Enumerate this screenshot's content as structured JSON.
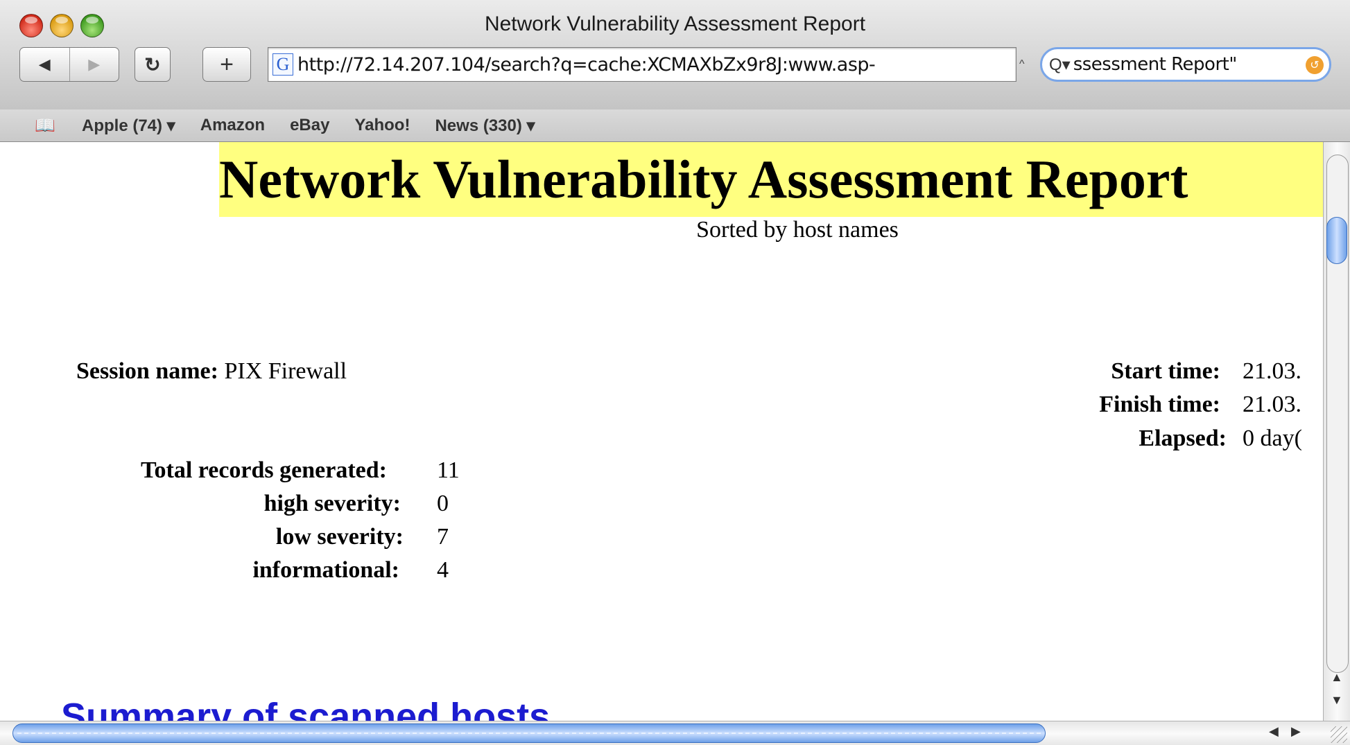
{
  "window": {
    "title": "Network Vulnerability Assessment Report"
  },
  "toolbar": {
    "back_icon": "back-arrow-icon",
    "forward_icon": "forward-arrow-icon",
    "reload_glyph": "↻",
    "add_glyph": "+",
    "url": "http://72.14.207.104/search?q=cache:XCMAXbZx9r8J:www.asp-",
    "favicon_letter": "G",
    "search_value": "ssessment Report\""
  },
  "bookmarks": {
    "items": [
      "Apple (74) ▾",
      "Amazon",
      "eBay",
      "Yahoo!",
      "News (330) ▾"
    ]
  },
  "report": {
    "title": "Network Vulnerability Assessment Report",
    "subtitle": "Sorted by host names",
    "session_label": "Session name:",
    "session_value": "PIX Firewall",
    "start_label": "Start time:",
    "start_value": "21.03.",
    "finish_label": "Finish time:",
    "finish_value": "21.03.",
    "elapsed_label": "Elapsed:",
    "elapsed_value": "0 day(",
    "stats": [
      {
        "label": "Total records generated:",
        "value": "11"
      },
      {
        "label": "high severity:",
        "value": "0"
      },
      {
        "label": "low severity:",
        "value": "7"
      },
      {
        "label": "informational:",
        "value": "4"
      }
    ],
    "summary_heading": "Summary of scanned hosts"
  },
  "colors": {
    "title_highlight": "#ffff80",
    "link_heading": "#1c1cd0",
    "scroll_thumb": "#6ea0e8"
  }
}
